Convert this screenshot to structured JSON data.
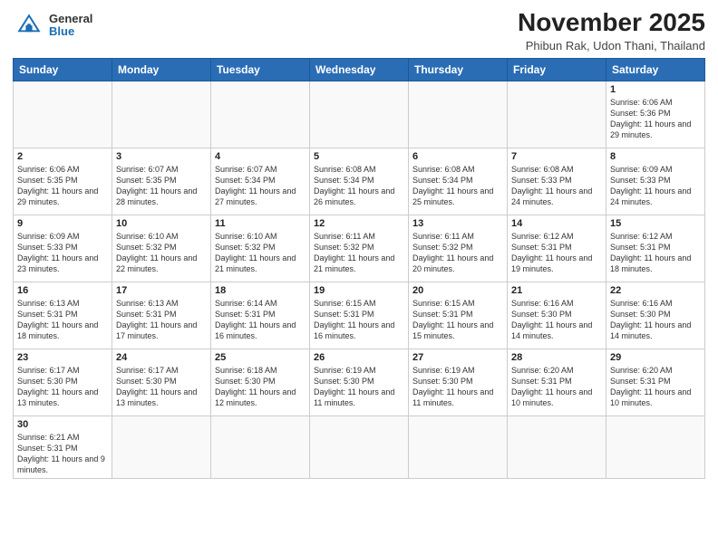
{
  "header": {
    "logo_general": "General",
    "logo_blue": "Blue",
    "month_title": "November 2025",
    "location": "Phibun Rak, Udon Thani, Thailand"
  },
  "weekdays": [
    "Sunday",
    "Monday",
    "Tuesday",
    "Wednesday",
    "Thursday",
    "Friday",
    "Saturday"
  ],
  "weeks": [
    [
      {
        "day": "",
        "info": ""
      },
      {
        "day": "",
        "info": ""
      },
      {
        "day": "",
        "info": ""
      },
      {
        "day": "",
        "info": ""
      },
      {
        "day": "",
        "info": ""
      },
      {
        "day": "",
        "info": ""
      },
      {
        "day": "1",
        "info": "Sunrise: 6:06 AM\nSunset: 5:36 PM\nDaylight: 11 hours and 29 minutes."
      }
    ],
    [
      {
        "day": "2",
        "info": "Sunrise: 6:06 AM\nSunset: 5:35 PM\nDaylight: 11 hours and 29 minutes."
      },
      {
        "day": "3",
        "info": "Sunrise: 6:07 AM\nSunset: 5:35 PM\nDaylight: 11 hours and 28 minutes."
      },
      {
        "day": "4",
        "info": "Sunrise: 6:07 AM\nSunset: 5:34 PM\nDaylight: 11 hours and 27 minutes."
      },
      {
        "day": "5",
        "info": "Sunrise: 6:08 AM\nSunset: 5:34 PM\nDaylight: 11 hours and 26 minutes."
      },
      {
        "day": "6",
        "info": "Sunrise: 6:08 AM\nSunset: 5:34 PM\nDaylight: 11 hours and 25 minutes."
      },
      {
        "day": "7",
        "info": "Sunrise: 6:08 AM\nSunset: 5:33 PM\nDaylight: 11 hours and 24 minutes."
      },
      {
        "day": "8",
        "info": "Sunrise: 6:09 AM\nSunset: 5:33 PM\nDaylight: 11 hours and 24 minutes."
      }
    ],
    [
      {
        "day": "9",
        "info": "Sunrise: 6:09 AM\nSunset: 5:33 PM\nDaylight: 11 hours and 23 minutes."
      },
      {
        "day": "10",
        "info": "Sunrise: 6:10 AM\nSunset: 5:32 PM\nDaylight: 11 hours and 22 minutes."
      },
      {
        "day": "11",
        "info": "Sunrise: 6:10 AM\nSunset: 5:32 PM\nDaylight: 11 hours and 21 minutes."
      },
      {
        "day": "12",
        "info": "Sunrise: 6:11 AM\nSunset: 5:32 PM\nDaylight: 11 hours and 21 minutes."
      },
      {
        "day": "13",
        "info": "Sunrise: 6:11 AM\nSunset: 5:32 PM\nDaylight: 11 hours and 20 minutes."
      },
      {
        "day": "14",
        "info": "Sunrise: 6:12 AM\nSunset: 5:31 PM\nDaylight: 11 hours and 19 minutes."
      },
      {
        "day": "15",
        "info": "Sunrise: 6:12 AM\nSunset: 5:31 PM\nDaylight: 11 hours and 18 minutes."
      }
    ],
    [
      {
        "day": "16",
        "info": "Sunrise: 6:13 AM\nSunset: 5:31 PM\nDaylight: 11 hours and 18 minutes."
      },
      {
        "day": "17",
        "info": "Sunrise: 6:13 AM\nSunset: 5:31 PM\nDaylight: 11 hours and 17 minutes."
      },
      {
        "day": "18",
        "info": "Sunrise: 6:14 AM\nSunset: 5:31 PM\nDaylight: 11 hours and 16 minutes."
      },
      {
        "day": "19",
        "info": "Sunrise: 6:15 AM\nSunset: 5:31 PM\nDaylight: 11 hours and 16 minutes."
      },
      {
        "day": "20",
        "info": "Sunrise: 6:15 AM\nSunset: 5:31 PM\nDaylight: 11 hours and 15 minutes."
      },
      {
        "day": "21",
        "info": "Sunrise: 6:16 AM\nSunset: 5:30 PM\nDaylight: 11 hours and 14 minutes."
      },
      {
        "day": "22",
        "info": "Sunrise: 6:16 AM\nSunset: 5:30 PM\nDaylight: 11 hours and 14 minutes."
      }
    ],
    [
      {
        "day": "23",
        "info": "Sunrise: 6:17 AM\nSunset: 5:30 PM\nDaylight: 11 hours and 13 minutes."
      },
      {
        "day": "24",
        "info": "Sunrise: 6:17 AM\nSunset: 5:30 PM\nDaylight: 11 hours and 13 minutes."
      },
      {
        "day": "25",
        "info": "Sunrise: 6:18 AM\nSunset: 5:30 PM\nDaylight: 11 hours and 12 minutes."
      },
      {
        "day": "26",
        "info": "Sunrise: 6:19 AM\nSunset: 5:30 PM\nDaylight: 11 hours and 11 minutes."
      },
      {
        "day": "27",
        "info": "Sunrise: 6:19 AM\nSunset: 5:30 PM\nDaylight: 11 hours and 11 minutes."
      },
      {
        "day": "28",
        "info": "Sunrise: 6:20 AM\nSunset: 5:31 PM\nDaylight: 11 hours and 10 minutes."
      },
      {
        "day": "29",
        "info": "Sunrise: 6:20 AM\nSunset: 5:31 PM\nDaylight: 11 hours and 10 minutes."
      }
    ],
    [
      {
        "day": "30",
        "info": "Sunrise: 6:21 AM\nSunset: 5:31 PM\nDaylight: 11 hours and 9 minutes."
      },
      {
        "day": "",
        "info": ""
      },
      {
        "day": "",
        "info": ""
      },
      {
        "day": "",
        "info": ""
      },
      {
        "day": "",
        "info": ""
      },
      {
        "day": "",
        "info": ""
      },
      {
        "day": "",
        "info": ""
      }
    ]
  ]
}
